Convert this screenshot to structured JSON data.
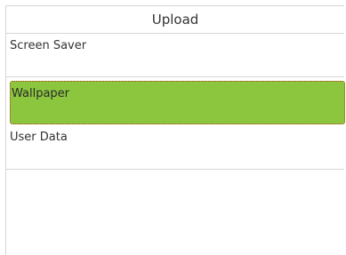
{
  "header": {
    "title": "Upload"
  },
  "menu": {
    "items": [
      {
        "label": "Screen Saver",
        "selected": false
      },
      {
        "label": "Wallpaper",
        "selected": true
      },
      {
        "label": "User Data",
        "selected": false
      }
    ]
  },
  "colors": {
    "selected_background": "#8cc63f",
    "selected_border": "#b5451b",
    "divider": "#d6d6d6"
  }
}
